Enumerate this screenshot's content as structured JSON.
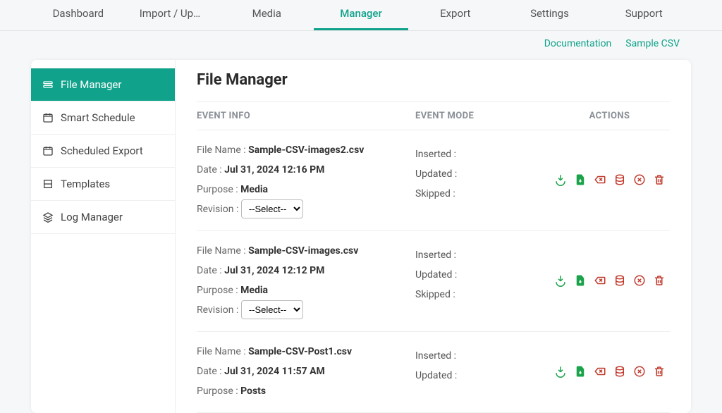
{
  "nav": {
    "tabs": [
      "Dashboard",
      "Import / Upda...",
      "Media",
      "Manager",
      "Export",
      "Settings",
      "Support"
    ],
    "active": 3,
    "links": {
      "docs": "Documentation",
      "sample": "Sample CSV"
    }
  },
  "sidebar": {
    "items": [
      {
        "label": "File Manager"
      },
      {
        "label": "Smart Schedule"
      },
      {
        "label": "Scheduled Export"
      },
      {
        "label": "Templates"
      },
      {
        "label": "Log Manager"
      }
    ],
    "active": 0
  },
  "page": {
    "title": "File Manager"
  },
  "table": {
    "headers": {
      "info": "EVENT INFO",
      "mode": "EVENT MODE",
      "actions": "ACTIONS"
    },
    "labels": {
      "filename": "File Name :",
      "date": "Date :",
      "purpose": "Purpose :",
      "revision": "Revision :",
      "inserted": "Inserted :",
      "updated": "Updated :",
      "skipped": "Skipped :"
    },
    "selectPlaceholder": "--Select--",
    "rows": [
      {
        "filename": "Sample-CSV-images2.csv",
        "date": "Jul 31, 2024 12:16 PM",
        "purpose": "Media",
        "showRevision": true,
        "showSkipped": true
      },
      {
        "filename": "Sample-CSV-images.csv",
        "date": "Jul 31, 2024 12:12 PM",
        "purpose": "Media",
        "showRevision": true,
        "showSkipped": true
      },
      {
        "filename": "Sample-CSV-Post1.csv",
        "date": "Jul 31, 2024 11:57 AM",
        "purpose": "Posts",
        "showRevision": false,
        "showSkipped": false
      }
    ]
  }
}
